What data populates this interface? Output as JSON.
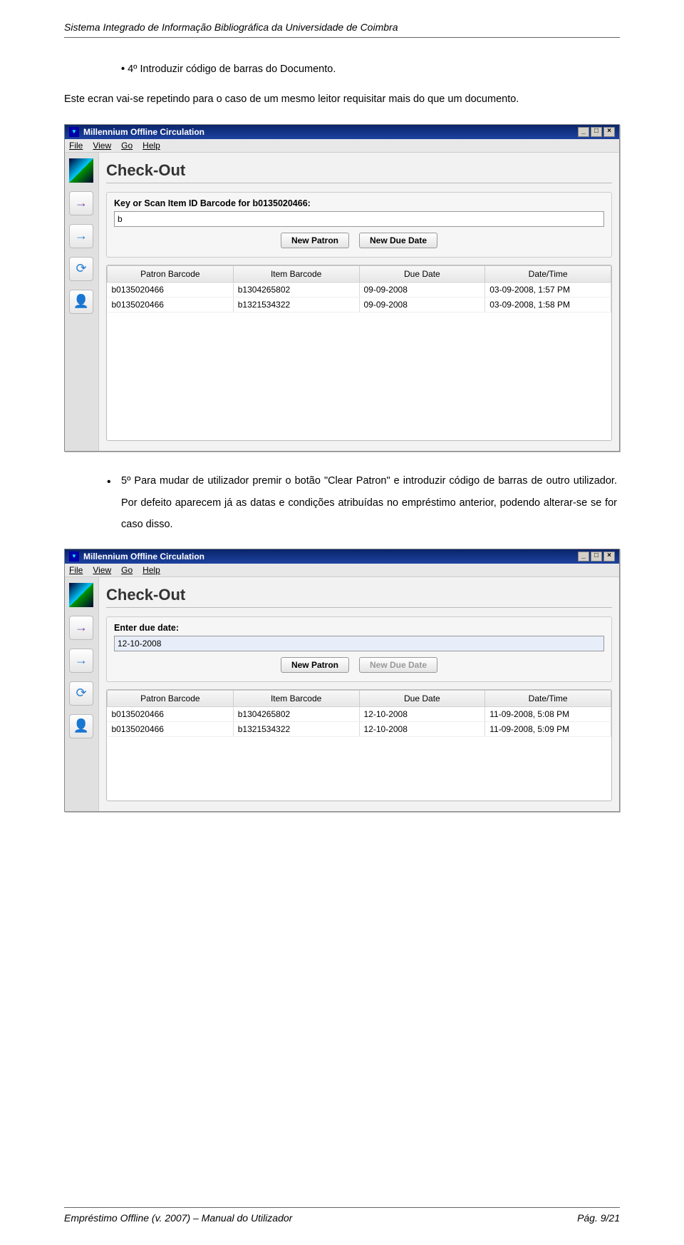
{
  "header": "Sistema Integrado de Informação Bibliográfica da Universidade de Coimbra",
  "intro_bullet": "4º Introduzir código de barras do Documento.",
  "intro_para": "Este ecran vai-se repetindo para o caso de um mesmo leitor requisitar mais do que um documento.",
  "window1": {
    "title": "Millennium Offline Circulation",
    "menu": {
      "file": "File",
      "view": "View",
      "go": "Go",
      "help": "Help"
    },
    "heading": "Check-Out",
    "prompt_label": "Key or Scan Item ID Barcode for b0135020466:",
    "prompt_value": "b",
    "btn_new_patron": "New Patron",
    "btn_new_due": "New Due Date",
    "headers": [
      "Patron Barcode",
      "Item Barcode",
      "Due Date",
      "Date/Time"
    ],
    "rows": [
      [
        "b0135020466",
        "b1304265802",
        "09-09-2008",
        "03-09-2008, 1:57 PM"
      ],
      [
        "b0135020466",
        "b1321534322",
        "09-09-2008",
        "03-09-2008, 1:58 PM"
      ]
    ]
  },
  "mid_bullet": "5º Para mudar de utilizador premir o botão \"Clear Patron\" e introduzir código de barras de outro utilizador. Por defeito aparecem já as datas e condições atribuídas no empréstimo anterior, podendo alterar-se se for caso disso.",
  "window2": {
    "title": "Millennium Offline Circulation",
    "menu": {
      "file": "File",
      "view": "View",
      "go": "Go",
      "help": "Help"
    },
    "heading": "Check-Out",
    "prompt_label": "Enter due date:",
    "prompt_value": "12-10-2008",
    "btn_new_patron": "New Patron",
    "btn_new_due": "New Due Date",
    "headers": [
      "Patron Barcode",
      "Item Barcode",
      "Due Date",
      "Date/Time"
    ],
    "rows": [
      [
        "b0135020466",
        "b1304265802",
        "12-10-2008",
        "11-09-2008, 5:08 PM"
      ],
      [
        "b0135020466",
        "b1321534322",
        "12-10-2008",
        "11-09-2008, 5:09 PM"
      ]
    ]
  },
  "footer_left": "Empréstimo Offline (v. 2007) – Manual do Utilizador",
  "footer_right": "Pág. 9/21"
}
